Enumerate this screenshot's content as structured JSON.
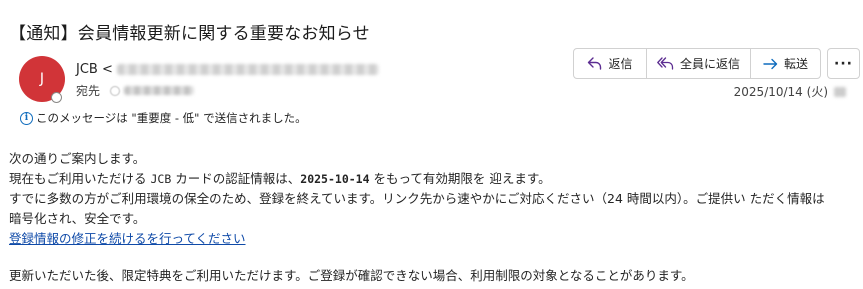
{
  "email": {
    "subject": "【通知】会員情報更新に関する重要なお知らせ",
    "avatar_initial": "J",
    "sender_name": "JCB <",
    "recipient_label": "宛先",
    "date": "2025/10/14 (火)",
    "importance_notice": "このメッセージは \"重要度 - 低\" で送信されました。"
  },
  "actions": {
    "reply": "返信",
    "reply_all": "全員に返信",
    "forward": "転送",
    "more": "···"
  },
  "body": {
    "line1": "次の通りご案内します。",
    "line2_a": "現在もご利用いただける",
    "line2_b": "JCB",
    "line2_c": "カードの認証情報は、",
    "line2_d": "2025-10-14",
    "line2_e": "をもって有効期限を 迎えます。",
    "line3": "すでに多数の方がご利用環境の保全のため、登録を終えています。リンク先から速やかにご対応ください（24 時間以内）。ご提供い ただく情報は",
    "line4": "暗号化され、安全です。",
    "link": "登録情報の修正を続けるを行ってください",
    "line6": "更新いただいた後、限定特典をご利用いただけます。ご登録が確認できない場合、利用制限の対象となることがあります。"
  },
  "colors": {
    "avatar": "#d13438",
    "link": "#0f4aa8",
    "info": "#0f6cbd"
  }
}
